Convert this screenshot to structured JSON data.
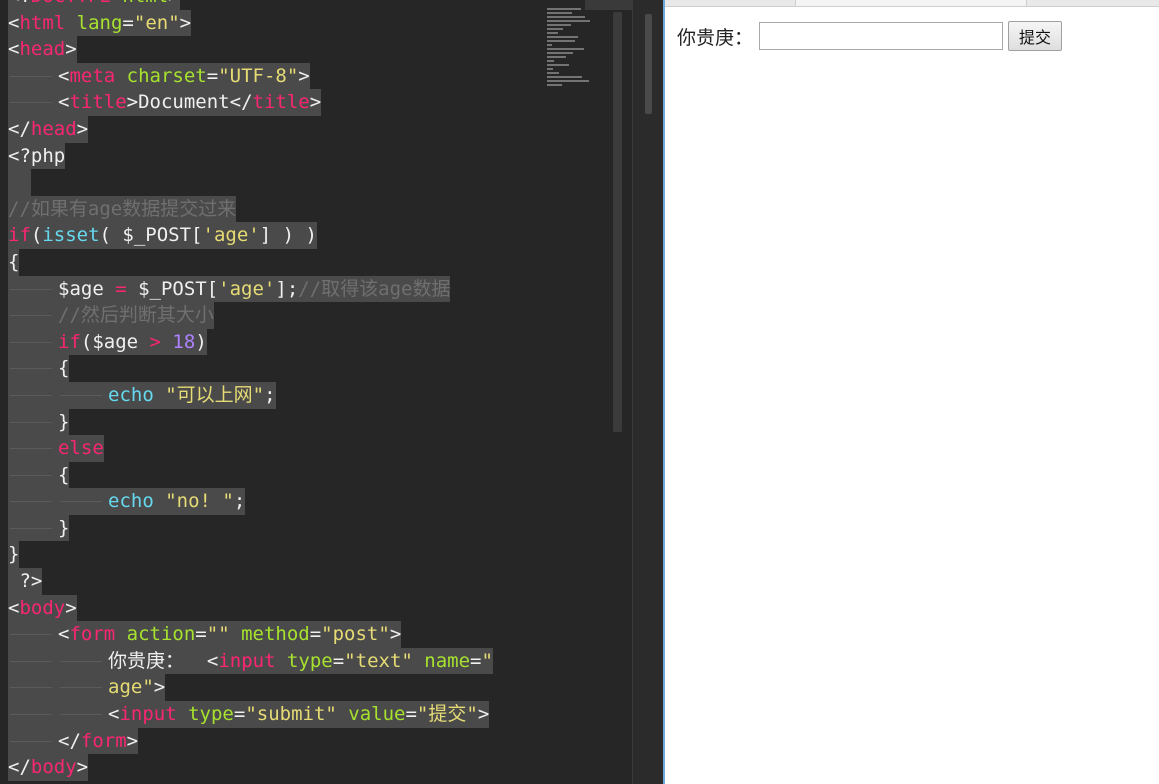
{
  "editor": {
    "lines": [
      [
        {
          "t": "<!",
          "c": "pun"
        },
        {
          "t": "DOCTYPE",
          "c": "tag"
        },
        {
          "t": " html",
          "c": "attr"
        },
        {
          "t": ">",
          "c": "pun"
        }
      ],
      [
        {
          "t": "<",
          "c": "pun"
        },
        {
          "t": "html",
          "c": "tag"
        },
        {
          "t": " lang",
          "c": "attr"
        },
        {
          "t": "=",
          "c": "pun"
        },
        {
          "t": "\"en\"",
          "c": "str"
        },
        {
          "t": ">",
          "c": "pun"
        }
      ],
      [
        {
          "t": "<",
          "c": "pun"
        },
        {
          "t": "head",
          "c": "tag"
        },
        {
          "t": ">",
          "c": "pun"
        }
      ],
      [
        {
          "i": 1
        },
        {
          "t": "<",
          "c": "pun"
        },
        {
          "t": "meta",
          "c": "tag"
        },
        {
          "t": " charset",
          "c": "attr"
        },
        {
          "t": "=",
          "c": "pun"
        },
        {
          "t": "\"UTF-8\"",
          "c": "str"
        },
        {
          "t": ">",
          "c": "pun"
        }
      ],
      [
        {
          "i": 1
        },
        {
          "t": "<",
          "c": "pun"
        },
        {
          "t": "title",
          "c": "tag"
        },
        {
          "t": ">",
          "c": "pun"
        },
        {
          "t": "Document",
          "c": "text"
        },
        {
          "t": "</",
          "c": "pun"
        },
        {
          "t": "title",
          "c": "tag"
        },
        {
          "t": ">",
          "c": "pun"
        }
      ],
      [
        {
          "t": "</",
          "c": "pun"
        },
        {
          "t": "head",
          "c": "tag"
        },
        {
          "t": ">",
          "c": "pun"
        }
      ],
      [
        {
          "t": "<?php",
          "c": "text"
        }
      ],
      [
        {
          "t": "  ",
          "c": "text"
        }
      ],
      [
        {
          "t": "//如果有age数据提交过来",
          "c": "com"
        }
      ],
      [
        {
          "t": "if",
          "c": "key"
        },
        {
          "t": "(",
          "c": "pun"
        },
        {
          "t": "isset",
          "c": "fn"
        },
        {
          "t": "( $_POST[",
          "c": "var"
        },
        {
          "t": "'age'",
          "c": "str"
        },
        {
          "t": "] ) )",
          "c": "pun"
        }
      ],
      [
        {
          "t": "{",
          "c": "pun"
        }
      ],
      [
        {
          "i": 1
        },
        {
          "t": "$age ",
          "c": "var"
        },
        {
          "t": "=",
          "c": "op"
        },
        {
          "t": " $_POST[",
          "c": "var"
        },
        {
          "t": "'age'",
          "c": "str"
        },
        {
          "t": "];",
          "c": "pun"
        },
        {
          "t": "//取得该age数据",
          "c": "com"
        }
      ],
      [
        {
          "i": 1
        },
        {
          "t": "//然后判断其大小",
          "c": "com"
        }
      ],
      [
        {
          "i": 1
        },
        {
          "t": "if",
          "c": "key"
        },
        {
          "t": "($age ",
          "c": "var"
        },
        {
          "t": ">",
          "c": "op"
        },
        {
          "t": " 18",
          "c": "num"
        },
        {
          "t": ")",
          "c": "pun"
        }
      ],
      [
        {
          "i": 1
        },
        {
          "t": "{",
          "c": "pun"
        }
      ],
      [
        {
          "i": 2
        },
        {
          "t": "echo",
          "c": "fn"
        },
        {
          "t": " ",
          "c": "pun"
        },
        {
          "t": "\"可以上网\"",
          "c": "str"
        },
        {
          "t": ";",
          "c": "pun"
        }
      ],
      [
        {
          "i": 1
        },
        {
          "t": "}",
          "c": "pun"
        }
      ],
      [
        {
          "i": 1
        },
        {
          "t": "else",
          "c": "key"
        }
      ],
      [
        {
          "i": 1
        },
        {
          "t": "{",
          "c": "pun"
        }
      ],
      [
        {
          "i": 2
        },
        {
          "t": "echo",
          "c": "fn"
        },
        {
          "t": " ",
          "c": "pun"
        },
        {
          "t": "\"no! \"",
          "c": "str"
        },
        {
          "t": ";",
          "c": "pun"
        }
      ],
      [
        {
          "i": 1
        },
        {
          "t": "}",
          "c": "pun"
        }
      ],
      [
        {
          "t": "}",
          "c": "pun"
        }
      ],
      [
        {
          "t": " ?>",
          "c": "text"
        }
      ],
      [
        {
          "t": "<",
          "c": "pun"
        },
        {
          "t": "body",
          "c": "tag"
        },
        {
          "t": ">",
          "c": "pun"
        }
      ],
      [
        {
          "i": 1
        },
        {
          "t": "<",
          "c": "pun"
        },
        {
          "t": "form",
          "c": "tag"
        },
        {
          "t": " action",
          "c": "attr"
        },
        {
          "t": "=",
          "c": "pun"
        },
        {
          "t": "\"\"",
          "c": "str"
        },
        {
          "t": " method",
          "c": "attr"
        },
        {
          "t": "=",
          "c": "pun"
        },
        {
          "t": "\"post\"",
          "c": "str"
        },
        {
          "t": ">",
          "c": "pun"
        }
      ],
      [
        {
          "i": 2
        },
        {
          "t": "你贵庚：  ",
          "c": "text"
        },
        {
          "t": "<",
          "c": "pun"
        },
        {
          "t": "input",
          "c": "tag"
        },
        {
          "t": " type",
          "c": "attr"
        },
        {
          "t": "=",
          "c": "pun"
        },
        {
          "t": "\"text\"",
          "c": "str"
        },
        {
          "t": " name",
          "c": "attr"
        },
        {
          "t": "=",
          "c": "pun"
        },
        {
          "t": "\"",
          "c": "str"
        }
      ],
      [
        {
          "i": 2
        },
        {
          "t": "age\"",
          "c": "str"
        },
        {
          "t": ">",
          "c": "pun"
        }
      ],
      [
        {
          "i": 2
        },
        {
          "t": "<",
          "c": "pun"
        },
        {
          "t": "input",
          "c": "tag"
        },
        {
          "t": " type",
          "c": "attr"
        },
        {
          "t": "=",
          "c": "pun"
        },
        {
          "t": "\"submit\"",
          "c": "str"
        },
        {
          "t": " value",
          "c": "attr"
        },
        {
          "t": "=",
          "c": "pun"
        },
        {
          "t": "\"提交\"",
          "c": "str"
        },
        {
          "t": ">",
          "c": "pun"
        }
      ],
      [
        {
          "i": 1
        },
        {
          "t": "</",
          "c": "pun"
        },
        {
          "t": "form",
          "c": "tag"
        },
        {
          "t": ">",
          "c": "pun"
        }
      ],
      [
        {
          "t": "</",
          "c": "pun"
        },
        {
          "t": "body",
          "c": "tag"
        },
        {
          "t": ">",
          "c": "pun"
        }
      ]
    ]
  },
  "browser": {
    "form": {
      "label": "你贵庚：",
      "input_value": "",
      "submit_label": "提交"
    }
  }
}
